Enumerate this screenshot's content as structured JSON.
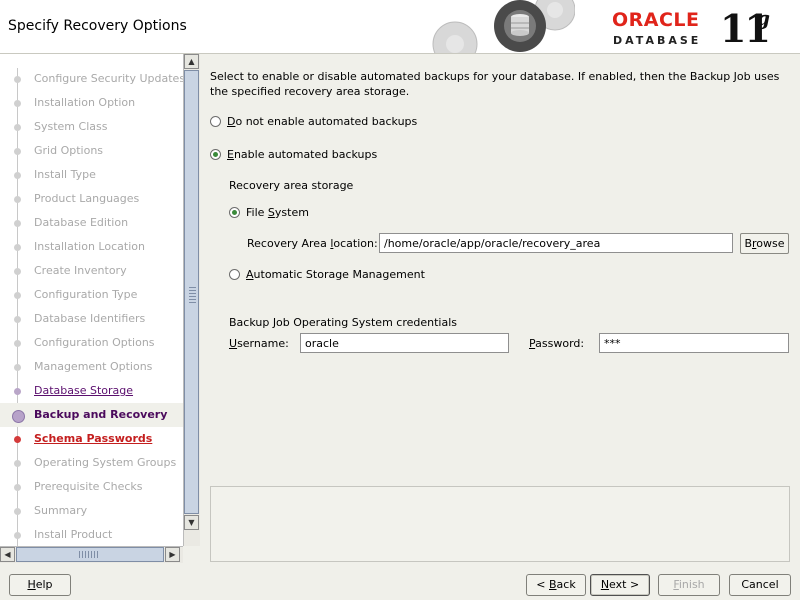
{
  "header": {
    "title": "Specify Recovery Options",
    "brand": "ORACLE",
    "product": "DATABASE",
    "version": "11",
    "version_suffix": "g"
  },
  "nav": {
    "items": [
      {
        "label": "Configure Security Updates",
        "state": "done"
      },
      {
        "label": "Installation Option",
        "state": "done"
      },
      {
        "label": "System Class",
        "state": "done"
      },
      {
        "label": "Grid Options",
        "state": "done"
      },
      {
        "label": "Install Type",
        "state": "done"
      },
      {
        "label": "Product Languages",
        "state": "done"
      },
      {
        "label": "Database Edition",
        "state": "done"
      },
      {
        "label": "Installation Location",
        "state": "done"
      },
      {
        "label": "Create Inventory",
        "state": "done"
      },
      {
        "label": "Configuration Type",
        "state": "done"
      },
      {
        "label": "Database Identifiers",
        "state": "done"
      },
      {
        "label": "Configuration Options",
        "state": "done"
      },
      {
        "label": "Management Options",
        "state": "done"
      },
      {
        "label": "Database Storage",
        "state": "link"
      },
      {
        "label": "Backup and Recovery",
        "state": "current"
      },
      {
        "label": "Schema Passwords",
        "state": "error"
      },
      {
        "label": "Operating System Groups",
        "state": "pending"
      },
      {
        "label": "Prerequisite Checks",
        "state": "pending"
      },
      {
        "label": "Summary",
        "state": "pending"
      },
      {
        "label": "Install Product",
        "state": "pending"
      }
    ]
  },
  "main": {
    "description": "Select to enable or disable automated backups for your database. If enabled, then the Backup Job uses the specified recovery area storage.",
    "opt_disable": {
      "mnemonic": "D",
      "rest": "o not enable automated backups",
      "selected": false
    },
    "opt_enable": {
      "mnemonic": "E",
      "rest": "nable automated backups",
      "selected": true
    },
    "storage_heading": "Recovery area storage",
    "opt_fs": {
      "pre": "File ",
      "mnemonic": "S",
      "rest": "ystem",
      "selected": true
    },
    "location_label_pre": "Recovery Area ",
    "location_label_mnemonic": "l",
    "location_label_rest": "ocation:",
    "location_value": "/home/oracle/app/oracle/recovery_area",
    "browse_pre": "B",
    "browse_mnemonic": "r",
    "browse_rest": "owse",
    "opt_asm": {
      "mnemonic": "A",
      "rest": "utomatic Storage Management",
      "selected": false
    },
    "creds_heading": "Backup Job Operating System credentials",
    "username_mnemonic": "U",
    "username_rest": "sername:",
    "username_value": "oracle",
    "password_mnemonic": "P",
    "password_rest": "assword:",
    "password_value": "***"
  },
  "buttons": {
    "help_mnemonic": "H",
    "help_rest": "elp",
    "back_prefix": "< ",
    "back_mnemonic": "B",
    "back_rest": "ack",
    "next_mnemonic": "N",
    "next_rest": "ext >",
    "finish_mnemonic": "F",
    "finish_rest": "inish",
    "cancel": "Cancel"
  },
  "colors": {
    "brand_red": "#e0241a",
    "nav_current": "#4b0a5c",
    "nav_error": "#c41e1e",
    "radio_on": "#3b8a3b"
  }
}
